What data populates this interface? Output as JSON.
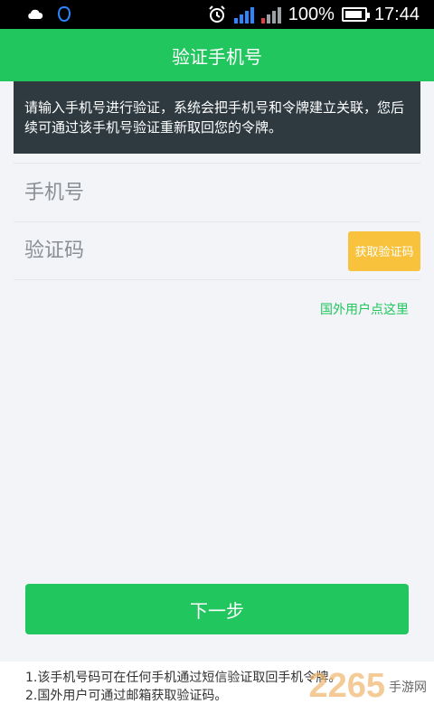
{
  "status_bar": {
    "battery": "100%",
    "time": "17:44",
    "icons": [
      "cloud-icon",
      "notification-icon",
      "alarm-icon",
      "signal-icon",
      "signal-no-service-icon",
      "battery-icon"
    ]
  },
  "header": {
    "title": "验证手机号"
  },
  "notice": {
    "text": "请输入手机号进行验证，系统会把手机号和令牌建立关联，您后续可通过该手机号验证重新取回您的令牌。"
  },
  "form": {
    "phone_placeholder": "手机号",
    "code_placeholder": "验证码",
    "get_code_label": "获取验证码"
  },
  "foreign_link": "国外用户点这里",
  "next_button": "下一步",
  "notes": [
    "1.该手机号码可在任何手机通过短信验证取回手机令牌。",
    "2.国外用户可通过邮箱获取验证码。"
  ],
  "watermark": {
    "number": "2265",
    "text": "手游网"
  },
  "colors": {
    "primary": "#21c65e",
    "notice_bg": "#2e3a40",
    "code_button": "#f8c23d"
  }
}
